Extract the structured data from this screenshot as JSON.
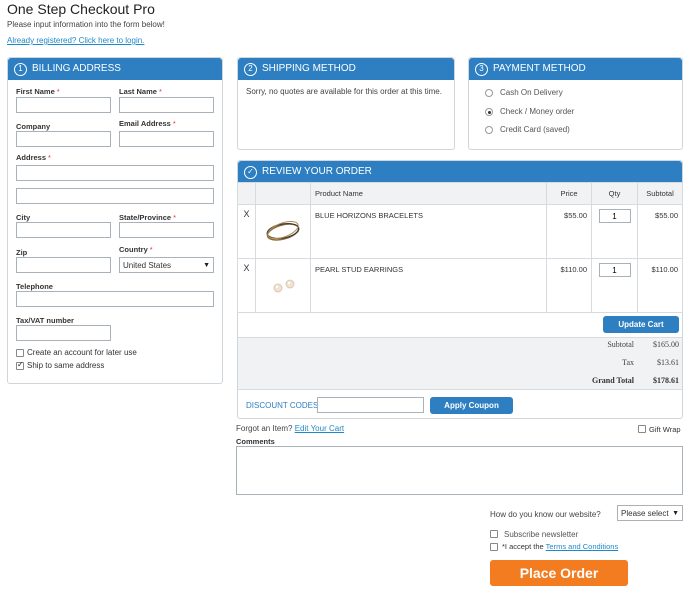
{
  "page": {
    "title": "One Step Checkout Pro",
    "subtitle": "Please input information into the form below!",
    "login_link": "Already registered? Click here to login."
  },
  "billing": {
    "step": "1",
    "heading": "BILLING ADDRESS",
    "first_name": "First Name",
    "last_name": "Last Name",
    "company": "Company",
    "email": "Email Address",
    "address": "Address",
    "city": "City",
    "state": "State/Province",
    "zip": "Zip",
    "country": "Country",
    "country_value": "United States",
    "telephone": "Telephone",
    "tax": "Tax/VAT number",
    "create_account": "Create an account for later use",
    "ship_same": "Ship to same address",
    "required_mark": "*"
  },
  "shipping": {
    "step": "2",
    "heading": "SHIPPING METHOD",
    "message": "Sorry, no quotes are available for this order at this time."
  },
  "payment": {
    "step": "3",
    "heading": "PAYMENT METHOD",
    "options": [
      "Cash On Delivery",
      "Check / Money order",
      "Credit Card (saved)"
    ]
  },
  "review": {
    "check": "✓",
    "heading": "REVIEW YOUR ORDER",
    "columns": {
      "product": "Product Name",
      "price": "Price",
      "qty": "Qty",
      "subtotal": "Subtotal"
    },
    "items": [
      {
        "remove": "X",
        "name": "BLUE HORIZONS BRACELETS",
        "price": "$55.00",
        "qty": "1",
        "subtotal": "$55.00"
      },
      {
        "remove": "X",
        "name": "PEARL STUD EARRINGS",
        "price": "$110.00",
        "qty": "1",
        "subtotal": "$110.00"
      }
    ],
    "update_cart": "Update Cart",
    "totals": {
      "subtotal_label": "Subtotal",
      "subtotal": "$165.00",
      "tax_label": "Tax",
      "tax": "$13.61",
      "grand_label": "Grand Total",
      "grand": "$178.61"
    },
    "discount_label": "DISCOUNT CODES",
    "apply_coupon": "Apply Coupon"
  },
  "extras": {
    "forgot": "Forgot an Item?",
    "edit_cart": "Edit Your Cart",
    "gift_wrap": "Gift Wrap",
    "comments": "Comments",
    "how_know": "How do you know our website?",
    "how_know_value": "Please select",
    "subscribe": "Subscribe newsletter",
    "accept_prefix": "*I accept the",
    "terms": "Terms and Conditions",
    "place_order": "Place Order"
  },
  "colors": {
    "accent": "#2d7fc1",
    "order_button": "#f47c20",
    "link": "#1e88c8"
  }
}
